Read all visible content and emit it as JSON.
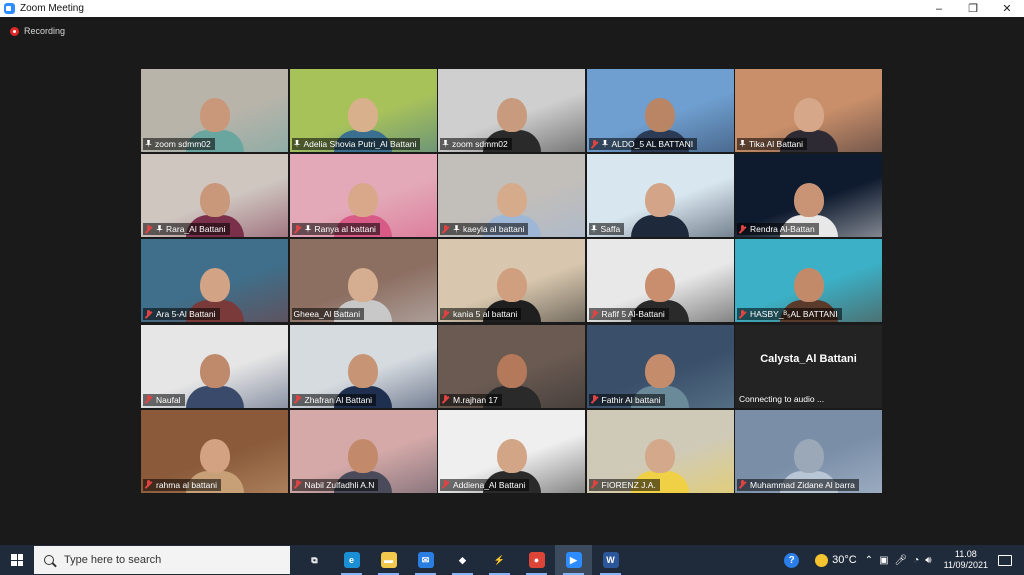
{
  "window": {
    "title": "Zoom Meeting",
    "minimize": "–",
    "restore": "❐",
    "close": "✕"
  },
  "recording": {
    "label": "Recording"
  },
  "tiles": [
    {
      "name": "zoom sdmm02",
      "muted": false,
      "pinned": true,
      "active": true,
      "bg": "#b9b4aa",
      "accent": "#6aa6a0",
      "skin": "#c9977a"
    },
    {
      "name": "Adelia Shovia Putri_Al Battani",
      "muted": false,
      "pinned": true,
      "bg": "#a8c25a",
      "accent": "#3a6f8f",
      "skin": "#d9b08c"
    },
    {
      "name": "zoom sdmm02",
      "muted": false,
      "pinned": true,
      "bg": "#cfcfcf",
      "accent": "#2a2a2a",
      "skin": "#c99b7e"
    },
    {
      "name": "ALDO_5 AL BATTANI",
      "muted": true,
      "pinned": true,
      "bg": "#6f9fd0",
      "accent": "#2b3b55",
      "skin": "#b98564"
    },
    {
      "name": "Tika Al Battani",
      "muted": false,
      "pinned": true,
      "bg": "#c98f6a",
      "accent": "#2d2a33",
      "skin": "#d6a889"
    },
    {
      "name": "Rara_Al Battani",
      "muted": true,
      "pinned": true,
      "bg": "#cfc6c0",
      "accent": "#7a2f4a",
      "skin": "#c9977a"
    },
    {
      "name": "Ranya al battani",
      "muted": true,
      "pinned": true,
      "bg": "#e3a9b8",
      "accent": "#d85a86",
      "skin": "#d9a88a"
    },
    {
      "name": "kaeyla al battani",
      "muted": true,
      "pinned": true,
      "bg": "#c2beba",
      "accent": "#9fb7d6",
      "skin": "#d5ab8c"
    },
    {
      "name": "Saffa",
      "muted": false,
      "pinned": true,
      "bg": "#d8e6ef",
      "accent": "#1e2a3c",
      "skin": "#d3a487"
    },
    {
      "name": "Rendra Al-Battan",
      "muted": true,
      "pinned": false,
      "bg": "#0e1a2e",
      "accent": "#e8e8e8",
      "skin": "#c99476"
    },
    {
      "name": "Ara 5-Al Battani",
      "muted": true,
      "pinned": false,
      "bg": "#3f6f8a",
      "accent": "#7a3a3a",
      "skin": "#d3a386"
    },
    {
      "name": "Gheea_Al Battani",
      "muted": false,
      "pinned": false,
      "bg": "#8d6f62",
      "accent": "#c8c8c8",
      "skin": "#d5ad90"
    },
    {
      "name": "kania 5 al battani",
      "muted": true,
      "pinned": false,
      "bg": "#d8c7ae",
      "accent": "#1f1f1f",
      "skin": "#cf9f80"
    },
    {
      "name": "Rafif 5 Al-Battani",
      "muted": true,
      "pinned": false,
      "bg": "#e8e8e8",
      "accent": "#2a2a2a",
      "skin": "#c98e6e"
    },
    {
      "name": "HASBY_ᴮ₅AL BATTANI",
      "muted": true,
      "pinned": false,
      "bg": "#3bb0c6",
      "accent": "#5a3a2a",
      "skin": "#c38a6a"
    },
    {
      "name": "Naufal",
      "muted": true,
      "pinned": false,
      "bg": "#e6e6e6",
      "accent": "#3a4a6a",
      "skin": "#bf8a6b"
    },
    {
      "name": "Zhafran Al Battani",
      "muted": true,
      "pinned": false,
      "bg": "#d6dbe0",
      "accent": "#1f2f4f",
      "skin": "#c79575"
    },
    {
      "name": "M.rajhan 17",
      "muted": true,
      "pinned": false,
      "bg": "#6a5a52",
      "accent": "#2a2a2a",
      "skin": "#b4785a"
    },
    {
      "name": "Fathir Al battani",
      "muted": true,
      "pinned": false,
      "bg": "#3a4f6a",
      "accent": "#6a8a9a",
      "skin": "#c58c6c"
    },
    {
      "name": "Calystа_Al Battani",
      "muted": false,
      "pinned": false,
      "noVideo": true,
      "status": "Connecting to audio ..."
    },
    {
      "name": "rahma al battani",
      "muted": true,
      "pinned": false,
      "bg": "#8a5a3a",
      "accent": "#c8a078",
      "skin": "#d3a283"
    },
    {
      "name": "Nabil Zulfadhli A.N",
      "muted": true,
      "pinned": false,
      "bg": "#d4a9a8",
      "accent": "#4a4a5a",
      "skin": "#c28a6a"
    },
    {
      "name": "Addiena_Al Battani",
      "muted": true,
      "pinned": false,
      "bg": "#efefef",
      "accent": "#2a2a2a",
      "skin": "#d3a587"
    },
    {
      "name": "FIORENZ J.A.",
      "muted": true,
      "pinned": false,
      "bg": "#cfcab8",
      "accent": "#f0d045",
      "skin": "#d4a88a"
    },
    {
      "name": "Muhammad Zidane Al barra",
      "muted": true,
      "pinned": false,
      "bg": "#7a8ea8",
      "accent": "#b8c6d6",
      "skin": "#9aa8b8"
    }
  ],
  "taskbar": {
    "search_placeholder": "Type here to search",
    "apps": [
      {
        "icon": "task-view-icon",
        "label": "⧉",
        "color": "transparent"
      },
      {
        "icon": "edge-icon",
        "label": "e",
        "color": "#1b8fd6"
      },
      {
        "icon": "file-explorer-icon",
        "label": "▬",
        "color": "#f2c94c"
      },
      {
        "icon": "mail-icon",
        "label": "✉",
        "color": "#2a7de1"
      },
      {
        "icon": "dropbox-icon",
        "label": "◆",
        "color": "transparent"
      },
      {
        "icon": "winamp-icon",
        "label": "⚡",
        "color": "transparent"
      },
      {
        "icon": "chrome-icon",
        "label": "●",
        "color": "#db4437"
      },
      {
        "icon": "zoom-icon",
        "label": "▶",
        "color": "#2d8cff"
      },
      {
        "icon": "word-icon",
        "label": "W",
        "color": "#2b579a"
      }
    ],
    "temperature": "30°C",
    "tray_arrow": "⌃",
    "time": "11.08",
    "date": "11/09/2021"
  }
}
